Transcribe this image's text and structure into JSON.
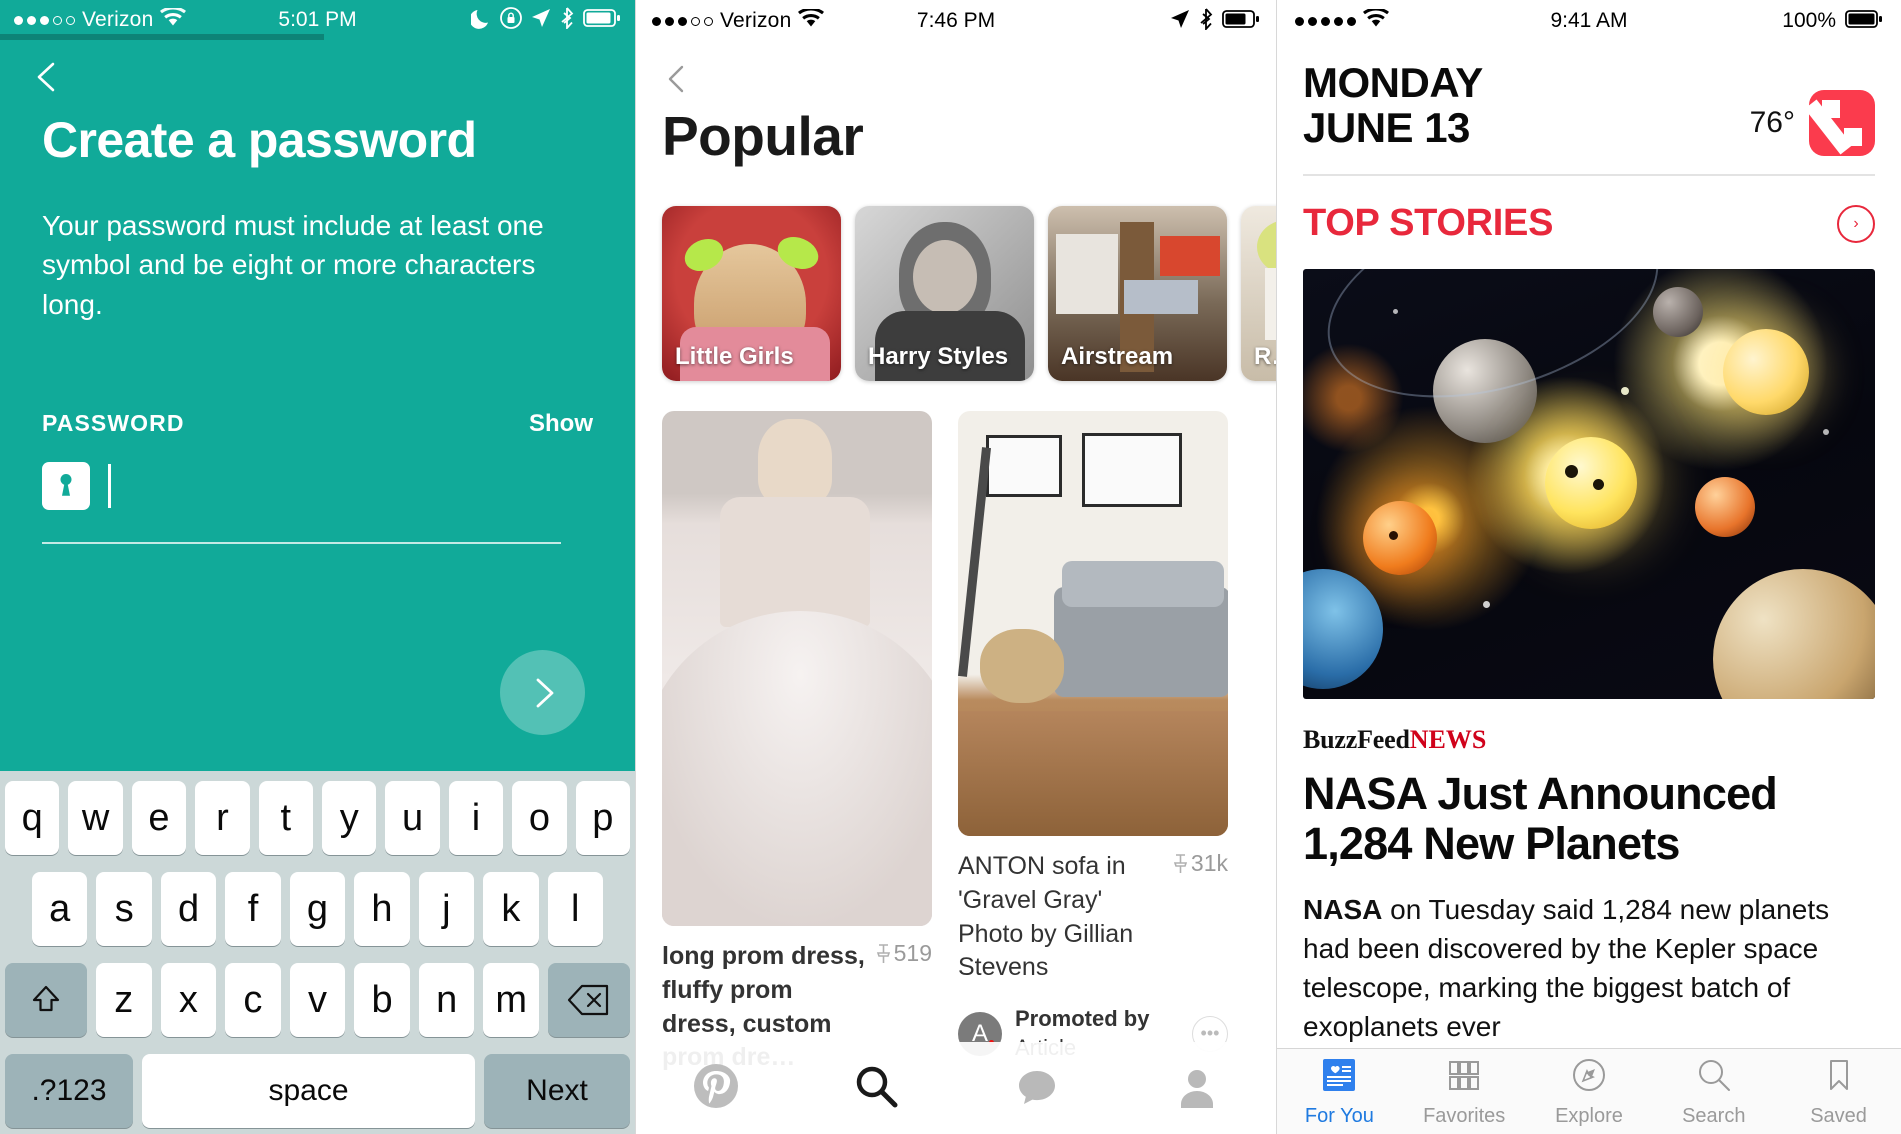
{
  "panel1": {
    "status": {
      "carrier": "Verizon",
      "time": "5:01 PM",
      "signal_filled": 3,
      "signal_total": 5,
      "icons": [
        "moon-icon",
        "lock-icon",
        "location-icon",
        "bluetooth-icon",
        "battery-icon"
      ]
    },
    "back_label": "Back",
    "title": "Create a password",
    "subtitle": "Your password must include at least one symbol and be eight or more characters long.",
    "field_label": "PASSWORD",
    "show_label": "Show",
    "password_value": "",
    "next_label": "Next",
    "keyboard": {
      "row1": [
        "q",
        "w",
        "e",
        "r",
        "t",
        "y",
        "u",
        "i",
        "o",
        "p"
      ],
      "row2": [
        "a",
        "s",
        "d",
        "f",
        "g",
        "h",
        "j",
        "k",
        "l"
      ],
      "row3": [
        "z",
        "x",
        "c",
        "v",
        "b",
        "n",
        "m"
      ],
      "shift": "shift",
      "backspace": "delete",
      "numbers": ".?123",
      "space": "space",
      "return": "Next"
    },
    "accent": "#11aa99",
    "progress_pct": 51
  },
  "panel2": {
    "status": {
      "carrier": "Verizon",
      "time": "7:46 PM",
      "signal_filled": 3,
      "signal_total": 5,
      "icons": [
        "location-icon",
        "bluetooth-icon",
        "battery-icon"
      ]
    },
    "title": "Popular",
    "categories": [
      {
        "label": "Little Girls"
      },
      {
        "label": "Harry Styles"
      },
      {
        "label": "Airstream"
      },
      {
        "label": "R… W…"
      }
    ],
    "pins": [
      {
        "title": "long prom dress, fluffy prom dress, custom prom dre…",
        "saves": "519"
      },
      {
        "title": "ANTON sofa in 'Gravel Gray' Photo by Gillian Stevens",
        "saves": "31k",
        "promoted_by": "Promoted by",
        "promoter": "Article",
        "avatar_letter": "A",
        "more": "•••"
      }
    ],
    "tabs": [
      "pinterest-home-icon",
      "search-icon",
      "messages-icon",
      "profile-icon"
    ]
  },
  "panel3": {
    "status": {
      "time": "9:41 AM",
      "battery_label": "100%",
      "signal_filled": 5,
      "signal_total": 5
    },
    "date_line1": "MONDAY",
    "date_line2": "JUNE 13",
    "temperature": "76°",
    "section_title": "TOP STORIES",
    "section_arrow": "›",
    "source_primary": "BuzzFeed",
    "source_secondary": "NEWS",
    "headline": "NASA Just Announced 1,284 New Planets",
    "dek_bold": "NASA",
    "dek": " on Tuesday said 1,284 new planets had been discovered by the Kepler space telescope, marking the biggest batch of exoplanets ever",
    "tabs": [
      {
        "label": "For You",
        "icon": "for-you-icon",
        "active": true
      },
      {
        "label": "Favorites",
        "icon": "favorites-icon",
        "active": false
      },
      {
        "label": "Explore",
        "icon": "explore-icon",
        "active": false
      },
      {
        "label": "Search",
        "icon": "search-icon",
        "active": false
      },
      {
        "label": "Saved",
        "icon": "bookmark-icon",
        "active": false
      }
    ],
    "accent_red": "#e8283c"
  }
}
